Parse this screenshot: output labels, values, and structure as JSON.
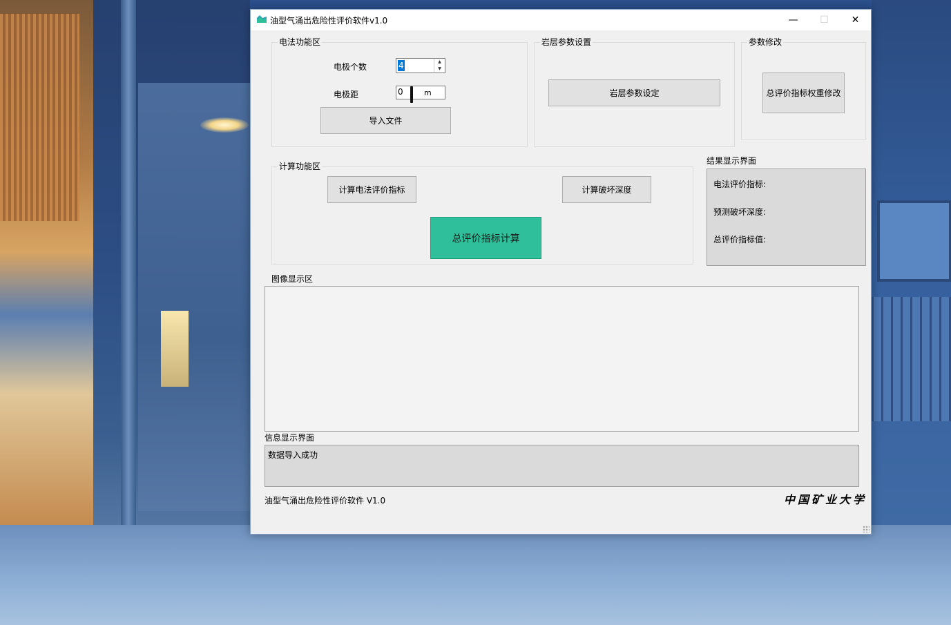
{
  "window": {
    "title": "油型气涌出危险性评价软件v1.0",
    "controls": {
      "minimize": "—",
      "maximize": "☐",
      "close": "✕"
    }
  },
  "electric": {
    "group_label": "电法功能区",
    "electrode_count_label": "电极个数",
    "electrode_count_value": "4",
    "electrode_spacing_label": "电极距",
    "electrode_spacing_value": "0",
    "electrode_spacing_unit": "m",
    "import_button": "导入文件"
  },
  "rock": {
    "group_label": "岩层参数设置",
    "set_button": "岩层参数设定"
  },
  "params": {
    "group_label": "参数修改",
    "weight_button": "总评价指标权重修改"
  },
  "calc": {
    "group_label": "计算功能区",
    "electric_index_button": "计算电法评价指标",
    "damage_depth_button": "计算破坏深度",
    "total_index_button": "总评价指标计算",
    "total_index_button_color": "#2fbf9a"
  },
  "results": {
    "label": "结果显示界面",
    "electric_index": "电法评价指标:",
    "damage_depth": "预测破坏深度:",
    "total_index": "总评价指标值:"
  },
  "image_area": {
    "label": "图像显示区"
  },
  "info": {
    "label": "信息显示界面",
    "message": "数据导入成功"
  },
  "footer": {
    "software_name": "油型气涌出危险性评价软件 V1.0",
    "university": "中国矿业大学"
  }
}
